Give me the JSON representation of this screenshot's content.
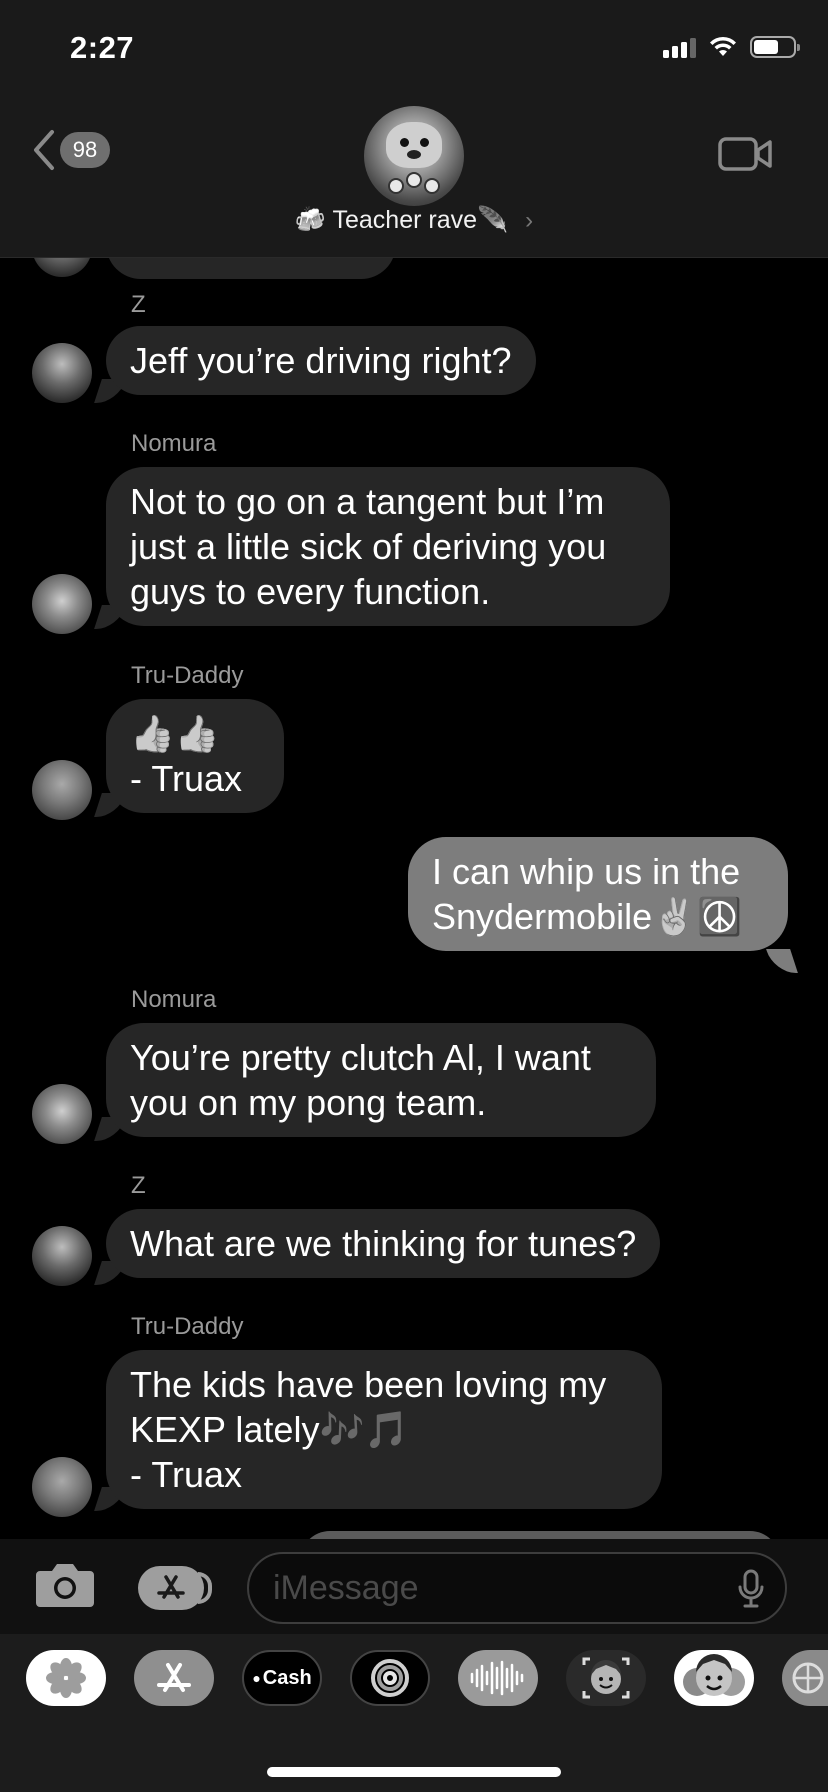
{
  "status": {
    "time": "2:27"
  },
  "header": {
    "back_count": "98",
    "group_name": "Teacher rave",
    "group_emoji_left": "🍻",
    "group_emoji_right": "🪶",
    "chevron": "›"
  },
  "messages": [
    {
      "sender": "Z",
      "lines": [
        "Jeff you’re driving right?"
      ]
    },
    {
      "sender": "Nomura",
      "lines": [
        "Not to go on a tangent but I’m",
        "just a little sick of deriving you",
        "guys to every function."
      ]
    },
    {
      "sender": "Tru-Daddy",
      "lines": [
        "👍👍",
        "- Truax"
      ]
    },
    {
      "sender": "",
      "lines": [
        "I can whip us in the",
        "Snydermobile✌️☮️"
      ]
    },
    {
      "sender": "Nomura",
      "lines": [
        "You’re pretty clutch Al, I want",
        "you on my pong team."
      ]
    },
    {
      "sender": "Z",
      "lines": [
        "What are we thinking for tunes?"
      ]
    },
    {
      "sender": "Tru-Daddy",
      "lines": [
        "The kids have been loving my",
        "KEXP lately🎶🎵",
        "- Truax"
      ]
    }
  ],
  "input": {
    "placeholder": "iMessage"
  },
  "drawer": {
    "cash_label": "Cash",
    "apps": [
      "photos-icon",
      "app-store-icon",
      "apple-cash-icon",
      "fitness-icon",
      "audio-icon",
      "memoji-stickers-icon",
      "animoji-icon",
      "web-search-icon"
    ]
  }
}
